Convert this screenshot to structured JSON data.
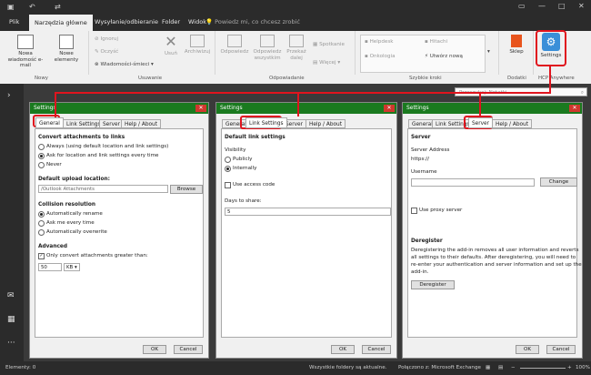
{
  "titlebar": {
    "qa_icons": [
      "save-icon",
      "undo-icon",
      "redo-icon"
    ],
    "window_controls": [
      "ribbon-display-icon",
      "minimize-icon",
      "maximize-icon",
      "close-icon"
    ]
  },
  "menu": {
    "tabs": [
      "Plik",
      "Narzędzia główne",
      "Wysyłanie/odbieranie",
      "Folder",
      "Widok"
    ],
    "active": "Narzędzia główne",
    "tellme": "Powiedz mi, co chcesz zrobić"
  },
  "ribbon": {
    "new_email": "Nowa wiadomość e-mail",
    "new_items": "Nowe elementy",
    "ignore": "Ignoruj",
    "cleanup": "Oczyść",
    "junk": "Wiadomości-śmieci",
    "delete": "Usuń",
    "archive": "Archiwizuj",
    "reply": "Odpowiedz",
    "reply_all": "Odpowiedz wszystkim",
    "forward": "Przekaż dalej",
    "meeting": "Spotkanie",
    "more": "Więcej",
    "quick1": "Helpdesk",
    "quick2": "Hitachi",
    "quick3": "Onkologia",
    "quick4": "Utwórz nową",
    "store": "Sklep",
    "settings": "Settings",
    "groups": [
      "Nowy",
      "Usuwanie",
      "Odpowiadanie",
      "Szybkie kroki",
      "Dodatki",
      "HCP Anywhere"
    ]
  },
  "search": {
    "placeholder": "Przeszukaj: Notatki"
  },
  "dialog1": {
    "title": "Settings",
    "tabs": [
      "General",
      "Link Settings",
      "Server",
      "Help / About"
    ],
    "convert_heading": "Convert attachments to links",
    "convert_opts": [
      "Always (using default location and link settings)",
      "Ask for location and link settings every time",
      "Never"
    ],
    "upload_heading": "Default upload location:",
    "upload_value": "/Outlook Attachments",
    "browse": "Browse",
    "collision_heading": "Collision resolution",
    "collision_opts": [
      "Automatically rename",
      "Ask me every time",
      "Automatically overwrite"
    ],
    "advanced_heading": "Advanced",
    "advanced_check": "Only convert attachments greater than:",
    "size_value": "50",
    "size_unit": "KB",
    "ok": "OK",
    "cancel": "Cancel"
  },
  "dialog2": {
    "title": "Settings",
    "tabs": [
      "General",
      "Link Settings",
      "Server",
      "Help / About"
    ],
    "heading": "Default link settings",
    "visibility": "Visibility",
    "vis_opts": [
      "Publicly",
      "Internally"
    ],
    "access_code": "Use access code",
    "days_label": "Days to share:",
    "days_value": "5",
    "ok": "OK",
    "cancel": "Cancel"
  },
  "dialog3": {
    "title": "Settings",
    "tabs": [
      "General",
      "Link Settings",
      "Server",
      "Help / About"
    ],
    "heading": "Server",
    "address_label": "Server Address",
    "address_value": "https://",
    "username_label": "Username",
    "change": "Change",
    "proxy": "Use proxy server",
    "dereg_heading": "Deregister",
    "dereg_text": [
      "Deregistering the add-in removes all user information and reverts",
      "all settings to their defaults. After deregistering, you will need to",
      "re-enter your authentication and server information and set up the",
      "add-in."
    ],
    "deregister": "Deregister",
    "ok": "OK",
    "cancel": "Cancel"
  },
  "status": {
    "elements": "Elementy: 0",
    "synced": "Wszystkie foldery są aktualne.",
    "connected": "Połączono z: Microsoft Exchange",
    "zoom": "100%"
  },
  "colors": {
    "dialog_title": "#1a7a1f",
    "highlight": "#e0141e",
    "close": "#d0382e"
  }
}
